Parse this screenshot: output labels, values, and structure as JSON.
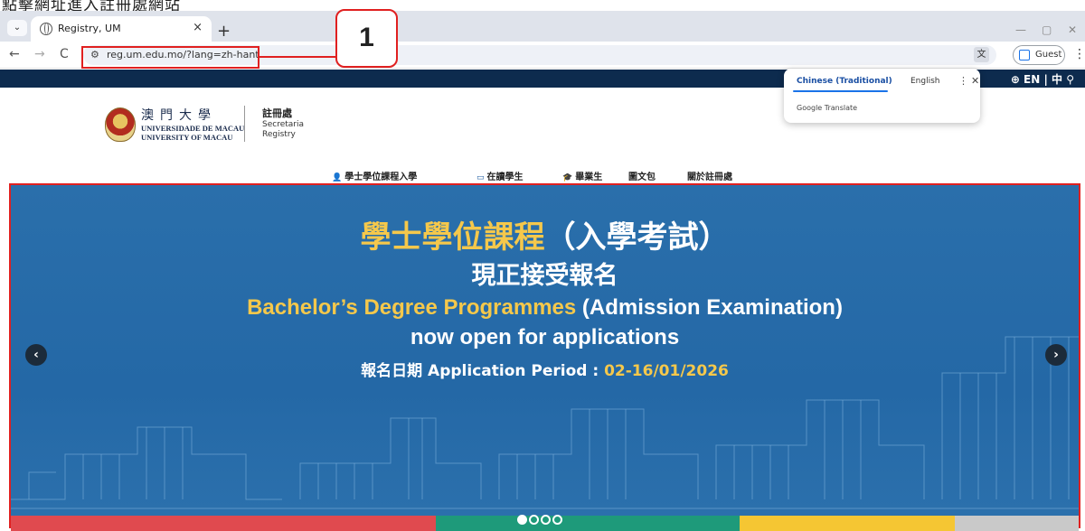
{
  "caption": "點擊網址進入註冊處網站",
  "browser": {
    "tab_title": "Registry, UM",
    "tab_close": "×",
    "new_tab": "+",
    "tab_list": "⌄",
    "url": "reg.um.edu.mo/?lang=zh-hant",
    "guest_label": "Guest",
    "win_minimize": "—",
    "win_restore": "▢",
    "win_close": "✕",
    "back": "←",
    "forward": "→",
    "reload": "C",
    "menu": "⋮"
  },
  "translate_popup": {
    "active_tab": "Chinese (Traditional)",
    "other_tab": "English",
    "menu_icon": "⋮",
    "close_icon": "✕",
    "brand": "Google Translate"
  },
  "site": {
    "topbar_langs": "⊕ EN | 中  ⚲",
    "university_cn": "澳門大學",
    "university_pt": "UNIVERSIDADE DE MACAU",
    "university_en": "UNIVERSITY OF MACAU",
    "dept_cn": "註冊處",
    "dept_pt": "Secretaria",
    "dept_en": "Registry",
    "nav": [
      {
        "icon": "👤",
        "label": "學士學位課程入學"
      },
      {
        "icon": "▭",
        "label": "在讀學生"
      },
      {
        "icon": "🎓",
        "label": "畢業生"
      },
      {
        "icon": "",
        "label": "圖文包"
      },
      {
        "icon": "",
        "label": "關於註冊處"
      }
    ]
  },
  "annotation": {
    "badge": "1"
  },
  "banner": {
    "line1_highlight": "學士學位課程",
    "line1_rest": "（入學考試）",
    "line2": "現正接受報名",
    "line3_highlight": "Bachelor’s Degree Programmes",
    "line3_rest": " (Admission Examination)",
    "line4": "now open for applications",
    "line5_label": "報名日期 Application Period : ",
    "line5_date": "02-16/01/2026",
    "prev": "‹",
    "next": "›",
    "slide_count": 4,
    "active_slide": 1
  },
  "colors": {
    "accent_red": "#e02020",
    "banner_blue": "#2468a6",
    "highlight_gold": "#f5c84b",
    "strip": [
      "#e04a4f",
      "#1e9a7a",
      "#f5c633",
      "#c9c9c9"
    ]
  }
}
